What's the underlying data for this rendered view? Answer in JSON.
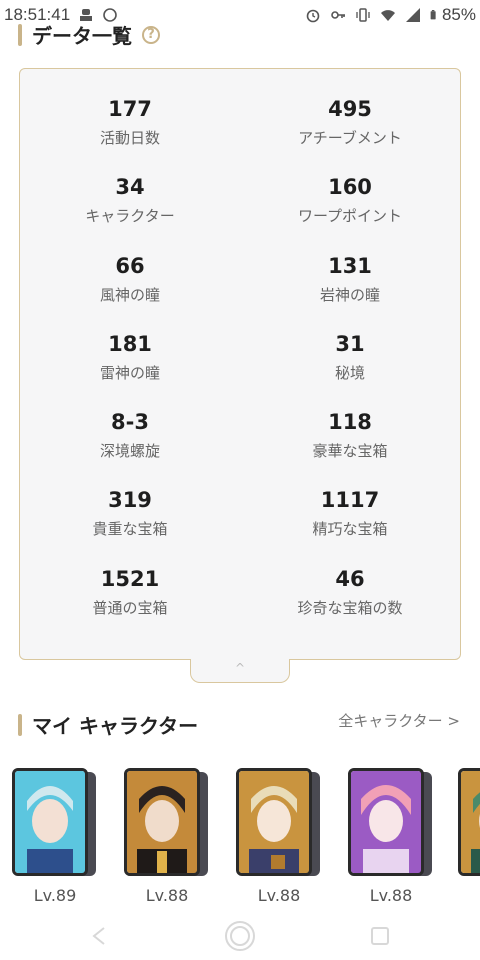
{
  "status": {
    "time": "18:51:41",
    "battery": "85%"
  },
  "data_section": {
    "title": "データ一覧",
    "help": "?"
  },
  "stats": [
    {
      "value": "177",
      "label": "活動日数"
    },
    {
      "value": "495",
      "label": "アチーブメント"
    },
    {
      "value": "34",
      "label": "キャラクター"
    },
    {
      "value": "160",
      "label": "ワープポイント"
    },
    {
      "value": "66",
      "label": "風神の瞳"
    },
    {
      "value": "131",
      "label": "岩神の瞳"
    },
    {
      "value": "181",
      "label": "雷神の瞳"
    },
    {
      "value": "31",
      "label": "秘境"
    },
    {
      "value": "8-3",
      "label": "深境螺旋"
    },
    {
      "value": "118",
      "label": "豪華な宝箱"
    },
    {
      "value": "319",
      "label": "貴重な宝箱"
    },
    {
      "value": "1117",
      "label": "精巧な宝箱"
    },
    {
      "value": "1521",
      "label": "普通の宝箱"
    },
    {
      "value": "46",
      "label": "珍奇な宝箱の数"
    }
  ],
  "characters_section": {
    "title": "マイ キャラクター",
    "all_link": "全キャラクター >"
  },
  "characters": [
    {
      "level": "Lv.89",
      "bg": "#5cc6df",
      "hair": "#cfe8ee",
      "accent": "#2d4f8c",
      "icon": "character-portrait-icon"
    },
    {
      "level": "Lv.88",
      "bg": "#c48a3a",
      "hair": "#2a2220",
      "accent": "#e0b24a",
      "icon": "character-portrait-icon"
    },
    {
      "level": "Lv.88",
      "bg": "#c9943f",
      "hair": "#e9dcb8",
      "accent": "#3a3f6a",
      "icon": "character-portrait-icon"
    },
    {
      "level": "Lv.88",
      "bg": "#9b5bc4",
      "hair": "#f1a0b6",
      "accent": "#e8d4f0",
      "icon": "character-portrait-icon"
    },
    {
      "level": "",
      "bg": "#c9943f",
      "hair": "#4a8a6a",
      "accent": "#2a5a4a",
      "icon": "character-portrait-icon"
    }
  ]
}
